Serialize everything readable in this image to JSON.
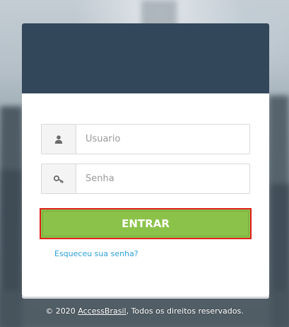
{
  "login": {
    "username": {
      "placeholder": "Usuario",
      "value": "",
      "icon": "user-icon"
    },
    "password": {
      "placeholder": "Senha",
      "value": "",
      "icon": "key-icon"
    },
    "submit_label": "ENTRAR",
    "forgot_label": "Esqueceu sua senha?"
  },
  "footer": {
    "copyright_prefix": "© 2020",
    "brand_link": "AccessBrasil",
    "suffix": ", Todos os direitos reservados."
  },
  "colors": {
    "header": "#33475b",
    "button": "#8bc34a",
    "button_highlight_border": "#e0201b",
    "link": "#2a9fd6"
  }
}
